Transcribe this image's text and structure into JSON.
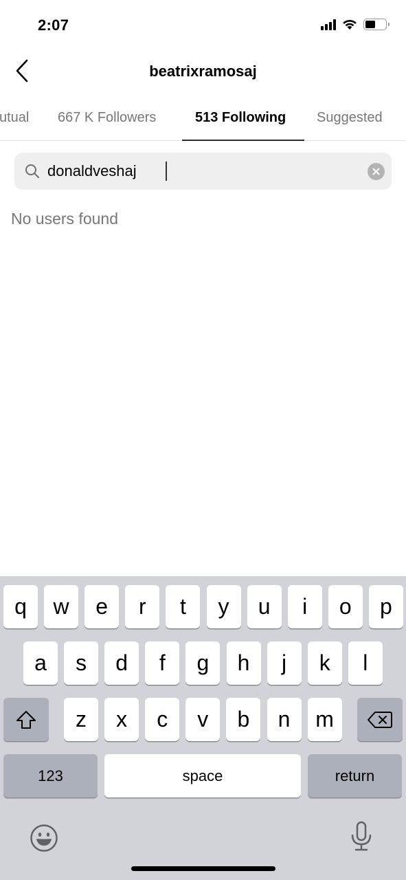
{
  "status_bar": {
    "time": "2:07",
    "icons": [
      "cellular-signal-icon",
      "wifi-icon",
      "battery-icon"
    ],
    "battery_level": 0.5
  },
  "header": {
    "back_icon": "chevron-left-icon",
    "title": "beatrixramosaj"
  },
  "tabs": [
    {
      "label": "utual",
      "active": false
    },
    {
      "label": "667 K Followers",
      "active": false
    },
    {
      "label": "513 Following",
      "active": true
    },
    {
      "label": "Suggested",
      "active": false
    }
  ],
  "search": {
    "icon": "search-icon",
    "value": "donaldveshaj",
    "clear_icon": "clear-icon"
  },
  "results": {
    "empty_message": "No users found"
  },
  "keyboard": {
    "row1": [
      "q",
      "w",
      "e",
      "r",
      "t",
      "y",
      "u",
      "i",
      "o",
      "p"
    ],
    "row2": [
      "a",
      "s",
      "d",
      "f",
      "g",
      "h",
      "j",
      "k",
      "l"
    ],
    "row3": [
      "z",
      "x",
      "c",
      "v",
      "b",
      "n",
      "m"
    ],
    "shift_icon": "shift-icon",
    "delete_icon": "backspace-icon",
    "numbers_label": "123",
    "space_label": "space",
    "return_label": "return",
    "emoji_icon": "emoji-icon",
    "mic_icon": "microphone-icon"
  },
  "colors": {
    "keyboard_bg": "#d1d3d9",
    "key_gray": "#abb0ba",
    "tab_inactive": "#777777",
    "search_bg": "#efefef"
  }
}
